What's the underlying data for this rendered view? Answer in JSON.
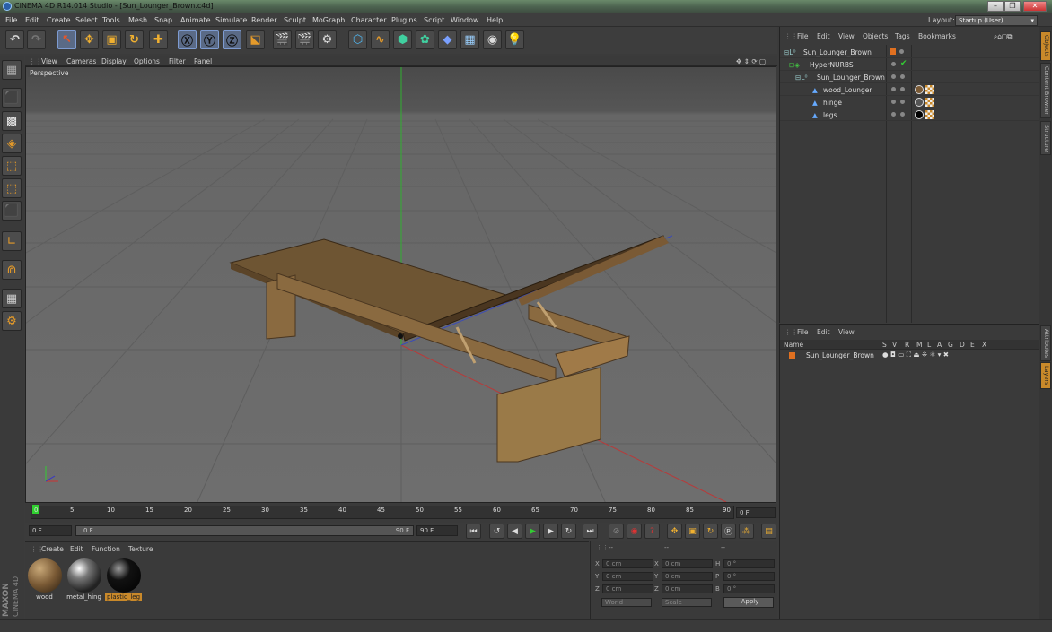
{
  "window": {
    "title": "CINEMA 4D R14.014 Studio - [Sun_Lounger_Brown.c4d]"
  },
  "menubar": [
    "File",
    "Edit",
    "Create",
    "Select",
    "Tools",
    "Mesh",
    "Snap",
    "Animate",
    "Simulate",
    "Render",
    "Sculpt",
    "MoGraph",
    "Character",
    "Plugins",
    "Script",
    "Window",
    "Help"
  ],
  "layout": {
    "label": "Layout:",
    "value": "Startup (User)"
  },
  "viewport_menu": [
    "View",
    "Cameras",
    "Display",
    "Options",
    "Filter",
    "Panel"
  ],
  "viewport": {
    "label": "Perspective"
  },
  "timeline": {
    "ticks": [
      "0",
      "5",
      "10",
      "15",
      "20",
      "25",
      "30",
      "35",
      "40",
      "45",
      "50",
      "55",
      "60",
      "65",
      "70",
      "75",
      "80",
      "85",
      "90"
    ],
    "current_frame": "0 F"
  },
  "transport": {
    "start": "0 F",
    "range_start": "0 F",
    "range_end": "90 F",
    "end": "90 F"
  },
  "material_menu": [
    "Create",
    "Edit",
    "Function",
    "Texture"
  ],
  "materials": [
    {
      "name": "wood",
      "color": "#7a5a35"
    },
    {
      "name": "metal_hing",
      "color": "#555555"
    },
    {
      "name": "plastic_leg",
      "color": "#111111"
    }
  ],
  "coords": {
    "header": [
      "--",
      "--",
      "--"
    ],
    "rows": [
      {
        "a": "X",
        "av": "0 cm",
        "b": "X",
        "bv": "0 cm",
        "c": "H",
        "cv": "0 °"
      },
      {
        "a": "Y",
        "av": "0 cm",
        "b": "Y",
        "bv": "0 cm",
        "c": "P",
        "cv": "0 °"
      },
      {
        "a": "Z",
        "av": "0 cm",
        "b": "Z",
        "bv": "0 cm",
        "c": "B",
        "cv": "0 °"
      }
    ],
    "mode1": "World",
    "mode2": "Scale",
    "apply": "Apply"
  },
  "object_menu": [
    "File",
    "Edit",
    "View",
    "Objects",
    "Tags",
    "Bookmarks"
  ],
  "objects": [
    {
      "name": "Sun_Lounger_Brown",
      "indent": 0
    },
    {
      "name": "HyperNURBS",
      "indent": 1
    },
    {
      "name": "Sun_Lounger_Brown",
      "indent": 2
    },
    {
      "name": "wood_Lounger",
      "indent": 3
    },
    {
      "name": "hinge",
      "indent": 3
    },
    {
      "name": "legs",
      "indent": 3
    }
  ],
  "layer_menu": [
    "File",
    "Edit",
    "View"
  ],
  "layer_header": {
    "name": "Name",
    "flags": [
      "S",
      "V",
      "R",
      "M",
      "L",
      "A",
      "G",
      "D",
      "E",
      "X"
    ]
  },
  "layers": [
    {
      "name": "Sun_Lounger_Brown"
    }
  ],
  "side_tabs": [
    "Objects",
    "Content Browser",
    "Structure"
  ],
  "side_tabs_lower": [
    "Attributes",
    "Layers"
  ],
  "brand": {
    "line1": "MAXON",
    "line2": "CINEMA 4D"
  },
  "colors": {
    "accent": "#c9892a",
    "selection": "#5a6a86"
  }
}
